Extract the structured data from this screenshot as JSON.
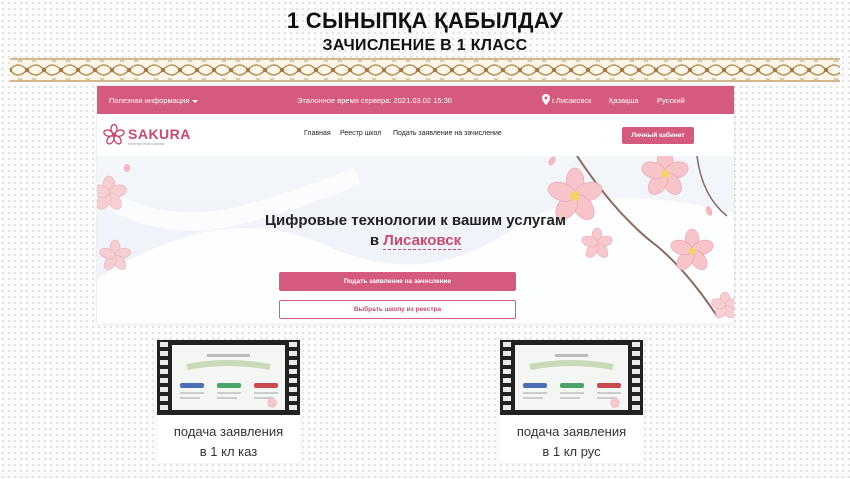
{
  "slide": {
    "title": "1 СЫНЫПҚА ҚАБЫЛДАУ",
    "subtitle": "ЗАЧИСЛЕНИЕ В 1 КЛАСС"
  },
  "colors": {
    "accent": "#d45a7e",
    "ornament": "#c9a86a"
  },
  "site": {
    "topbar": {
      "useful_info": "Полезная информация",
      "server_time": "Эталонное время сервера: 2021.03.02 15:30",
      "city": "г.Лисаковск",
      "lang_kz": "Қазақша",
      "lang_ru": "Русский"
    },
    "logo": {
      "name": "SAKURA",
      "tagline": "электронная школа"
    },
    "nav": {
      "home": "Главная",
      "registry": "Реестр школ",
      "apply": "Подать заявление на зачисление",
      "cabinet": "Личный кабинет"
    },
    "hero": {
      "line1": "Цифровые технологии к вашим услугам",
      "prefix": "в",
      "city": "Лисаковск",
      "btn_apply": "Подать заявление на зачисление",
      "btn_choose": "Выбрать школу из реестра"
    }
  },
  "videos": [
    {
      "line1": "подача заявления",
      "line2": "в 1 кл каз"
    },
    {
      "line1": "подача заявления",
      "line2": "в 1 кл рус"
    }
  ]
}
